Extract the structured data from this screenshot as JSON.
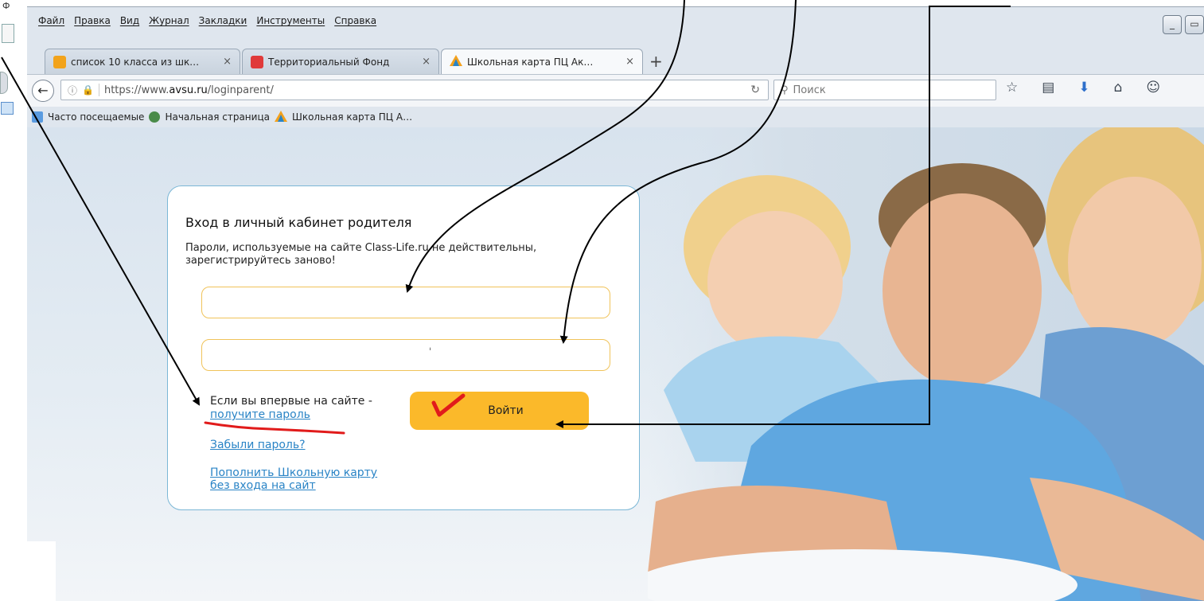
{
  "browser": {
    "side_letters": "Ф",
    "menu": [
      "Файл",
      "Правка",
      "Вид",
      "Журнал",
      "Закладки",
      "Инструменты",
      "Справка"
    ],
    "tabs": [
      {
        "title": "список 10 класса из шк…",
        "icon": "mail-icon",
        "color": "#f2a31b"
      },
      {
        "title": "Территориальный Фонд",
        "icon": "fund-icon",
        "color": "#e03a3a"
      },
      {
        "title": "Школьная карта ПЦ Ак…",
        "icon": "triangle-logo-icon",
        "color": "#f4a11c"
      }
    ],
    "tab_close": "×",
    "new_tab": "+",
    "url_prefix": "https://www.",
    "url_host": "avsu.ru",
    "url_path": "/loginparent/",
    "search_placeholder": "Поиск",
    "bookmarks": [
      "Часто посещаемые",
      "Начальная страница",
      "Школьная карта ПЦ А…"
    ]
  },
  "login": {
    "title": "Вход в личный кабинет родителя",
    "note": "Пароли, используемые на сайте Class-Life.ru не действительны, зарегистрируйтесь заново!",
    "password_mark": "ˈ",
    "first_time": "Если вы впервые на сайте -",
    "get_password": "получите пароль",
    "forgot": "Забыли пароль?",
    "topup": "Пополнить Школьную карту без входа на сайт",
    "submit": "Войти"
  },
  "colors": {
    "accent_button": "#fbb92a",
    "link": "#2a84c6",
    "field_border": "#f0c35a",
    "card_border": "#7bb7d6",
    "annotation_underline": "#e11b1b"
  }
}
